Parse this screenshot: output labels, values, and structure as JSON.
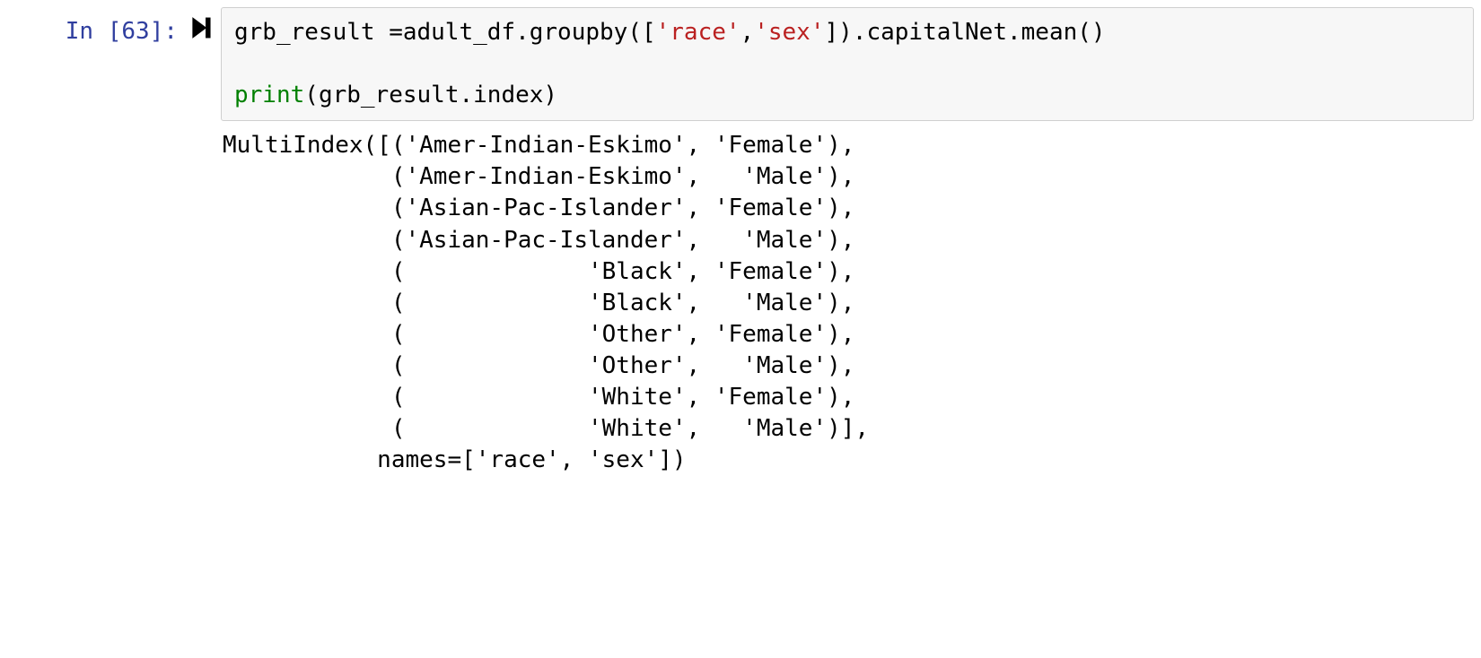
{
  "cell": {
    "prompt_prefix": "In [",
    "exec_count": "63",
    "prompt_suffix": "]:",
    "code": {
      "line1": {
        "a": "grb_result ",
        "op1": "=",
        "b": "adult_df",
        "dot1": ".",
        "c": "groupby",
        "lp1": "([",
        "s1": "'race'",
        "comma1": ",",
        "s2": "'sex'",
        "rp1": "])",
        "dot2": ".",
        "d": "capitalNet",
        "dot3": ".",
        "e": "mean",
        "call1": "()"
      },
      "blank": "",
      "line2": {
        "p": "print",
        "lp": "(",
        "a": "grb_result",
        "dot": ".",
        "b": "index",
        "rp": ")"
      }
    },
    "output": "MultiIndex([('Amer-Indian-Eskimo', 'Female'),\n            ('Amer-Indian-Eskimo',   'Male'),\n            ('Asian-Pac-Islander', 'Female'),\n            ('Asian-Pac-Islander',   'Male'),\n            (             'Black', 'Female'),\n            (             'Black',   'Male'),\n            (             'Other', 'Female'),\n            (             'Other',   'Male'),\n            (             'White', 'Female'),\n            (             'White',   'Male')],\n           names=['race', 'sex'])"
  }
}
